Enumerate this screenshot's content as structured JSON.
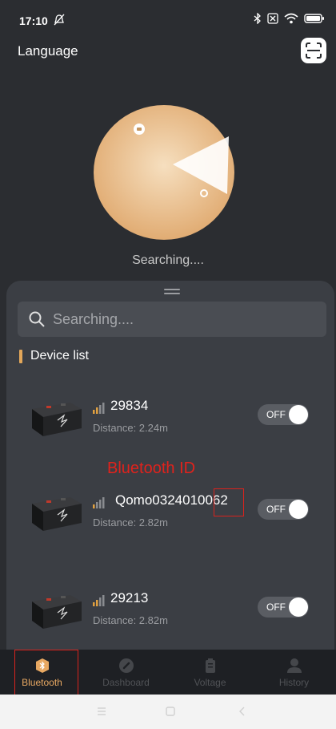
{
  "status_bar": {
    "time": "17:10",
    "icons": [
      "mute-icon",
      "bluetooth-icon",
      "sim-icon",
      "wifi-icon",
      "battery-icon"
    ]
  },
  "header": {
    "language_label": "Language",
    "scan_icon": "scan-icon"
  },
  "radar": {
    "status_text": "Searching....",
    "colors": {
      "center": "#f6dfbf",
      "edge": "#e1ac73"
    }
  },
  "search": {
    "placeholder": "Searching...."
  },
  "device_list": {
    "title": "Device list",
    "accent": "#e3a75a",
    "devices": [
      {
        "name": "29834",
        "distance": "Distance: 2.24m",
        "toggle": "OFF"
      },
      {
        "name": "Qomo0324010062",
        "distance": "Distance: 2.82m",
        "toggle": "OFF"
      },
      {
        "name": "29213",
        "distance": "Distance: 2.82m",
        "toggle": "OFF"
      }
    ]
  },
  "annotation": {
    "label": "Bluetooth ID",
    "color": "#e0221c"
  },
  "tabs": [
    {
      "label": "Bluetooth",
      "icon": "bluetooth-tab-icon",
      "active": true
    },
    {
      "label": "Dashboard",
      "icon": "dashboard-icon",
      "active": false
    },
    {
      "label": "Voltage",
      "icon": "battery-tab-icon",
      "active": false
    },
    {
      "label": "History",
      "icon": "user-icon",
      "active": false
    }
  ]
}
